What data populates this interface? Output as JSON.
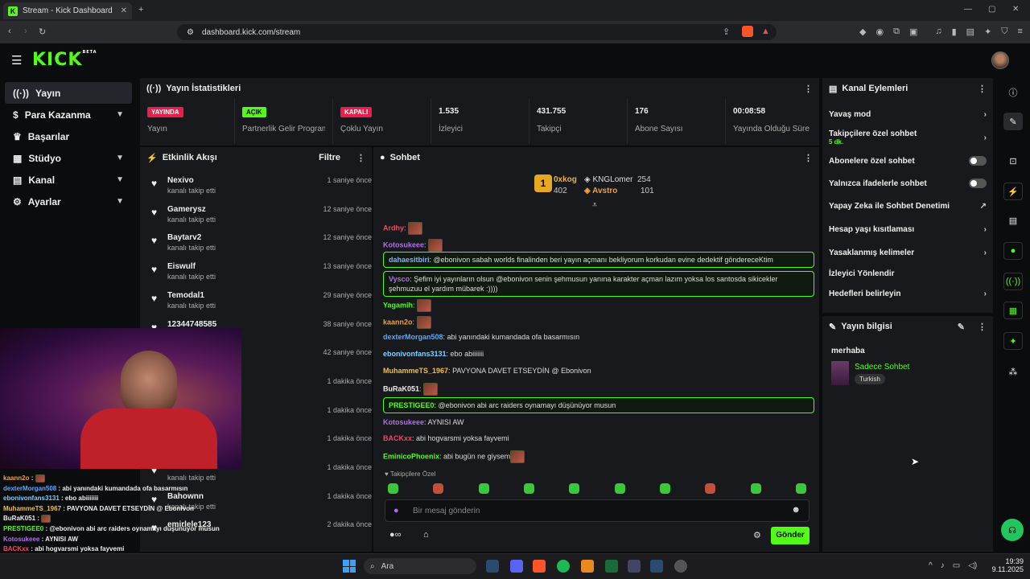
{
  "browser": {
    "tab_title": "Stream - Kick Dashboard",
    "url": "dashboard.kick.com/stream"
  },
  "brand": {
    "logo": "KICK",
    "logo_sup": "BETA",
    "accent": "#53fc18"
  },
  "sidebar": {
    "items": [
      {
        "label": "Yayın",
        "icon": "broadcast-icon"
      },
      {
        "label": "Para Kazanma",
        "icon": "dollar-icon"
      },
      {
        "label": "Başarılar",
        "icon": "trophy-icon"
      },
      {
        "label": "Stüdyo",
        "icon": "studio-icon"
      },
      {
        "label": "Kanal",
        "icon": "channel-icon"
      },
      {
        "label": "Ayarlar",
        "icon": "gear-icon"
      }
    ]
  },
  "stats": {
    "title": "Yayın İstatistikleri",
    "cells": [
      {
        "badge": "YAYINDA",
        "badge_color": "#e91e4c",
        "label": "Yayın"
      },
      {
        "badge": "AÇIK",
        "badge_color": "#53fc18",
        "label": "Partnerlik Gelir Programı"
      },
      {
        "badge": "KAPALI",
        "badge_color": "#e91e4c",
        "label": "Çoklu Yayın"
      },
      {
        "value": "1.535",
        "label": "İzleyici"
      },
      {
        "value": "431.755",
        "label": "Takipçi"
      },
      {
        "value": "176",
        "label": "Abone Sayısı"
      },
      {
        "value": "00:08:58",
        "label": "Yayında Olduğu Süre"
      }
    ]
  },
  "activity": {
    "title": "Etkinlik Akışı",
    "filter": "Filtre",
    "items": [
      {
        "name": "Nexivo",
        "sub": "kanalı takip etti",
        "time": "1 saniye önce"
      },
      {
        "name": "Gamerysz",
        "sub": "kanalı takip etti",
        "time": "12 saniye önce"
      },
      {
        "name": "Baytarv2",
        "sub": "kanalı takip etti",
        "time": "12 saniye önce"
      },
      {
        "name": "Eiswulf",
        "sub": "kanalı takip etti",
        "time": "13 saniye önce"
      },
      {
        "name": "Temodal1",
        "sub": "kanalı takip etti",
        "time": "29 saniye önce"
      },
      {
        "name": "12344748585",
        "sub": "",
        "time": "38 saniye önce"
      },
      {
        "name": "",
        "sub": "",
        "time": "42 saniye önce"
      },
      {
        "name": "",
        "sub": "",
        "time": "1 dakika önce"
      },
      {
        "name": "",
        "sub": "",
        "time": "1 dakika önce"
      },
      {
        "name": "",
        "sub": "",
        "time": "1 dakika önce"
      },
      {
        "name": "",
        "sub": "kanalı takip etti",
        "time": "1 dakika önce"
      },
      {
        "name": "Bahownn",
        "sub": "kanalı takip etti",
        "time": "1 dakika önce"
      },
      {
        "name": "emirlele123",
        "sub": "",
        "time": "2 dakika önce"
      }
    ]
  },
  "chat": {
    "title": "Sohbet",
    "leaderboard": {
      "first": {
        "rank": "1",
        "name": "0xkog",
        "score": "402"
      },
      "second": {
        "name": "KNGLomer",
        "score": "254"
      },
      "third": {
        "name": "Avstro",
        "score": "101"
      }
    },
    "messages": [
      {
        "user": "Ardhy",
        "color": "#e94b6a",
        "text": "",
        "emote": true,
        "hl": false
      },
      {
        "user": "Kotosukeee",
        "color": "#b46cf0",
        "text": "",
        "emote": true,
        "hl": false
      },
      {
        "user": "dahaesitbiri",
        "color": "#7fb2ff",
        "text": "@ebonivon sabah worlds finalinden beri yayın açmanı bekliyorum korkudan evine dedektif göndereceKtim",
        "emote": false,
        "hl": true
      },
      {
        "user": "Vysco",
        "color": "#b46cf0",
        "text": "Şefim iyi yayınların olsun @ebonivon senin şehmusun yanına karakter açman lazım yoksa los santosda sikicekler şehmuzuu el yardım mübarek :))))",
        "emote": false,
        "hl": true
      },
      {
        "user": "Yagamih",
        "color": "#53fc18",
        "text": "",
        "emote": true,
        "hl": false
      },
      {
        "user": "kaann2o",
        "color": "#f0a040",
        "text": "",
        "emote": true,
        "hl": false
      },
      {
        "user": "dexterMorgan508",
        "color": "#5aa8ff",
        "text": "abi yanındaki kumandada ofa basarmısın",
        "emote": false,
        "hl": false
      },
      {
        "user": "ebonivonfans3131",
        "color": "#7fd0ff",
        "text": "ebo abiiiiiii",
        "emote": false,
        "hl": false
      },
      {
        "user": "MuhammeTS_1967",
        "color": "#f0c040",
        "text": "PAVYONA DAVET ETSEYDİN @ Ebonivon",
        "emote": false,
        "hl": false
      },
      {
        "user": "BuRaK051",
        "color": "#eee",
        "text": "",
        "emote": true,
        "hl": false
      },
      {
        "user": "PRESTIGEE0",
        "color": "#53fc18",
        "text": "@ebonivon abi arc raiders oynamayı düşünüyor musun",
        "emote": false,
        "hl": true
      },
      {
        "user": "Kotosukeee",
        "color": "#b46cf0",
        "text": "AYNISI AW",
        "emote": false,
        "hl": false
      },
      {
        "user": "BACKxx",
        "color": "#e94b6a",
        "text": "abi hogvarsmi yoksa fayvemi",
        "emote": false,
        "hl": false
      },
      {
        "user": "EminicoPhoenix",
        "color": "#53fc18",
        "text": "abi bugün ne giysem",
        "emote": true,
        "hl": false
      }
    ],
    "followers_only": "Takipçilere Özel",
    "input_placeholder": "Bir mesaj gönderin",
    "send_label": "Gönder"
  },
  "channel_actions": {
    "title": "Kanal Eylemleri",
    "items": [
      {
        "label": "Yavaş mod",
        "type": "chevron",
        "sub": ""
      },
      {
        "label": "Takipçilere özel sohbet",
        "type": "chevron",
        "sub": "5 dk."
      },
      {
        "label": "Abonelere özel sohbet",
        "type": "toggle",
        "sub": ""
      },
      {
        "label": "Yalnızca ifadelerle sohbet",
        "type": "toggle",
        "sub": ""
      },
      {
        "label": "Yapay Zeka ile Sohbet Denetimi",
        "type": "external",
        "sub": ""
      },
      {
        "label": "Hesap yaşı kısıtlaması",
        "type": "chevron",
        "sub": ""
      },
      {
        "label": "Yasaklanmış kelimeler",
        "type": "chevron",
        "sub": ""
      },
      {
        "label": "İzleyici Yönlendir",
        "type": "none",
        "sub": ""
      },
      {
        "label": "Hedefleri belirleyin",
        "type": "chevron",
        "sub": ""
      }
    ]
  },
  "stream_info": {
    "title": "Yayın bilgisi",
    "stream_title": "merhaba",
    "category": "Sadece Sohbet",
    "tag": "Turkish"
  },
  "overlay_chat": [
    {
      "user": "kaann2o",
      "color": "#f0a040",
      "text": ""
    },
    {
      "user": "dexterMorgan508",
      "color": "#5aa8ff",
      "text": "abi yanındaki kumandada ofa basarmısın"
    },
    {
      "user": "ebonivonfans3131",
      "color": "#7fd0ff",
      "text": "ebo abiiiiiii"
    },
    {
      "user": "MuhammeTS_1967",
      "color": "#f0c040",
      "text": "PAVYONA DAVET ETSEYDİN @ Ebonivon"
    },
    {
      "user": "BuRaK051",
      "color": "#eee",
      "text": ""
    },
    {
      "user": "PRESTIGEE0",
      "color": "#53fc18",
      "text": "@ebonivon abi arc raiders oynamayı düşünüyor musun"
    },
    {
      "user": "Kotosukeee",
      "color": "#b46cf0",
      "text": "AYNISI AW"
    },
    {
      "user": "BACKxx",
      "color": "#e94b6a",
      "text": "abi hogvarsmi yoksa fayvemi"
    },
    {
      "user": "EminicoPhoenix",
      "color": "#53fc18",
      "text": "abi bugün ne giysem"
    }
  ],
  "taskbar": {
    "search": "Ara",
    "time": "19:39",
    "date": "9.11.2025"
  }
}
